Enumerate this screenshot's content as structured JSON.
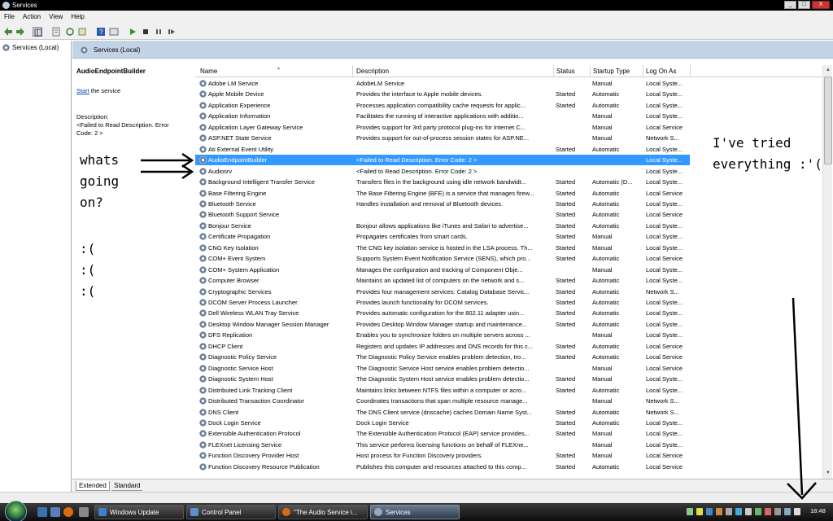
{
  "window": {
    "title": "Services",
    "min": "_",
    "max": "□",
    "close": "X"
  },
  "menu": [
    "File",
    "Action",
    "View",
    "Help"
  ],
  "tree": {
    "root": "Services (Local)"
  },
  "header": {
    "title": "Services (Local)"
  },
  "selected_panel": {
    "service_name": "AudioEndpointBuilder",
    "start_link": "Start",
    "start_suffix": " the service",
    "description_label": "Description:",
    "description_text": "<Failed to Read Description. Error Code: 2 >"
  },
  "columns": [
    "Name",
    "Description",
    "Status",
    "Startup Type",
    "Log On As"
  ],
  "rows": [
    {
      "name": "Adobe LM Service",
      "desc": "AdobeLM Service",
      "status": "",
      "type": "Manual",
      "logon": "Local Syste..."
    },
    {
      "name": "Apple Mobile Device",
      "desc": "Provides the interface to Apple mobile devices.",
      "status": "Started",
      "type": "Automatic",
      "logon": "Local Syste..."
    },
    {
      "name": "Application Experience",
      "desc": "Processes application compatibility cache requests for applic...",
      "status": "Started",
      "type": "Automatic",
      "logon": "Local Syste..."
    },
    {
      "name": "Application Information",
      "desc": "Facilitates the running of interactive applications with additio...",
      "status": "",
      "type": "Manual",
      "logon": "Local Syste..."
    },
    {
      "name": "Application Layer Gateway Service",
      "desc": "Provides support for 3rd party protocol plug-ins for Internet C...",
      "status": "",
      "type": "Manual",
      "logon": "Local Service"
    },
    {
      "name": "ASP.NET State Service",
      "desc": "Provides support for out-of-process session states for ASP.NE...",
      "status": "",
      "type": "Manual",
      "logon": "Network S..."
    },
    {
      "name": "Ati External Event Utility",
      "desc": "",
      "status": "Started",
      "type": "Automatic",
      "logon": "Local Syste..."
    },
    {
      "name": "AudioEndpointBuilder",
      "desc": "<Failed to Read Description. Error Code: 2 >",
      "status": "",
      "type": "",
      "logon": "Local Syste...",
      "selected": true
    },
    {
      "name": "Audiosrv",
      "desc": "<Failed to Read Description. Error Code: 2 >",
      "status": "",
      "type": "",
      "logon": "Local Syste..."
    },
    {
      "name": "Background Intelligent Transfer Service",
      "desc": "Transfers files in the background using idle network bandwidt...",
      "status": "Started",
      "type": "Automatic (D...",
      "logon": "Local Syste..."
    },
    {
      "name": "Base Filtering Engine",
      "desc": "The Base Filtering Engine (BFE) is a service that manages firew...",
      "status": "Started",
      "type": "Automatic",
      "logon": "Local Service"
    },
    {
      "name": "Bluetooth Service",
      "desc": "Handles installation and removal of Bluetooth devices.",
      "status": "Started",
      "type": "Automatic",
      "logon": "Local Syste..."
    },
    {
      "name": "Bluetooth Support Service",
      "desc": "",
      "status": "Started",
      "type": "Automatic",
      "logon": "Local Service"
    },
    {
      "name": "Bonjour Service",
      "desc": "Bonjour allows applications like iTunes and Safari to advertise...",
      "status": "Started",
      "type": "Automatic",
      "logon": "Local Syste..."
    },
    {
      "name": "Certificate Propagation",
      "desc": "Propagates certificates from smart cards.",
      "status": "Started",
      "type": "Manual",
      "logon": "Local Syste..."
    },
    {
      "name": "CNG Key Isolation",
      "desc": "The CNG key isolation service is hosted in the LSA process. Th...",
      "status": "Started",
      "type": "Manual",
      "logon": "Local Syste..."
    },
    {
      "name": "COM+ Event System",
      "desc": "Supports System Event Notification Service (SENS), which pro...",
      "status": "Started",
      "type": "Automatic",
      "logon": "Local Service"
    },
    {
      "name": "COM+ System Application",
      "desc": "Manages the configuration and tracking of Component Obje...",
      "status": "",
      "type": "Manual",
      "logon": "Local Syste..."
    },
    {
      "name": "Computer Browser",
      "desc": "Maintains an updated list of computers on the network and s...",
      "status": "Started",
      "type": "Automatic",
      "logon": "Local Syste..."
    },
    {
      "name": "Cryptographic Services",
      "desc": "Provides four management services: Catalog Database Servic...",
      "status": "Started",
      "type": "Automatic",
      "logon": "Network S..."
    },
    {
      "name": "DCOM Server Process Launcher",
      "desc": "Provides launch functionality for DCOM services.",
      "status": "Started",
      "type": "Automatic",
      "logon": "Local Syste..."
    },
    {
      "name": "Dell Wireless WLAN Tray Service",
      "desc": "Provides automatic configuration for the 802.11 adapter usin...",
      "status": "Started",
      "type": "Automatic",
      "logon": "Local Syste..."
    },
    {
      "name": "Desktop Window Manager Session Manager",
      "desc": "Provides Desktop Window Manager startup and maintenance...",
      "status": "Started",
      "type": "Automatic",
      "logon": "Local Syste..."
    },
    {
      "name": "DFS Replication",
      "desc": "Enables you to synchronize folders on multiple servers across ...",
      "status": "",
      "type": "Manual",
      "logon": "Local Syste..."
    },
    {
      "name": "DHCP Client",
      "desc": "Registers and updates IP addresses and DNS records for this c...",
      "status": "Started",
      "type": "Automatic",
      "logon": "Local Service"
    },
    {
      "name": "Diagnostic Policy Service",
      "desc": "The Diagnostic Policy Service enables problem detection, tro...",
      "status": "Started",
      "type": "Automatic",
      "logon": "Local Service"
    },
    {
      "name": "Diagnostic Service Host",
      "desc": "The Diagnostic Service Host service enables problem detectio...",
      "status": "",
      "type": "Manual",
      "logon": "Local Service"
    },
    {
      "name": "Diagnostic System Host",
      "desc": "The Diagnostic System Host service enables problem detectio...",
      "status": "Started",
      "type": "Manual",
      "logon": "Local Syste..."
    },
    {
      "name": "Distributed Link Tracking Client",
      "desc": "Maintains links between NTFS files within a computer or acro...",
      "status": "Started",
      "type": "Automatic",
      "logon": "Local Syste..."
    },
    {
      "name": "Distributed Transaction Coordinator",
      "desc": "Coordinates transactions that span multiple resource manage...",
      "status": "",
      "type": "Manual",
      "logon": "Network S..."
    },
    {
      "name": "DNS Client",
      "desc": "The DNS Client service (dnscache) caches Domain Name Syst...",
      "status": "Started",
      "type": "Automatic",
      "logon": "Network S..."
    },
    {
      "name": "Dock Login Service",
      "desc": "Dock Login Service",
      "status": "Started",
      "type": "Automatic",
      "logon": "Local Syste..."
    },
    {
      "name": "Extensible Authentication Protocol",
      "desc": "The Extensible Authentication Protocol (EAP) service provides...",
      "status": "Started",
      "type": "Manual",
      "logon": "Local Syste..."
    },
    {
      "name": "FLEXnet Licensing Service",
      "desc": "This service performs licensing functions on behalf of FLEXne...",
      "status": "",
      "type": "Manual",
      "logon": "Local Syste..."
    },
    {
      "name": "Function Discovery Provider Host",
      "desc": "Host process for Function Discovery providers.",
      "status": "Started",
      "type": "Manual",
      "logon": "Local Service"
    },
    {
      "name": "Function Discovery Resource Publication",
      "desc": "Publishes this computer and resources attached to this comp...",
      "status": "Started",
      "type": "Automatic",
      "logon": "Local Service"
    }
  ],
  "view_tabs": [
    "Extended",
    "Standard"
  ],
  "taskbar": {
    "buttons": [
      "Windows Update",
      "Control Panel",
      "\"The Audio Service i...",
      "Services"
    ],
    "clock": "18:48"
  },
  "annotations": {
    "left": "whats\ngoing\non?",
    "sad": ":(\n:(\n:(",
    "right": "I've tried\neverything :'("
  },
  "colors": {
    "selection": "#3399ff",
    "header_band": "#c3d3e6",
    "taskbar": "#1a1a1a"
  }
}
